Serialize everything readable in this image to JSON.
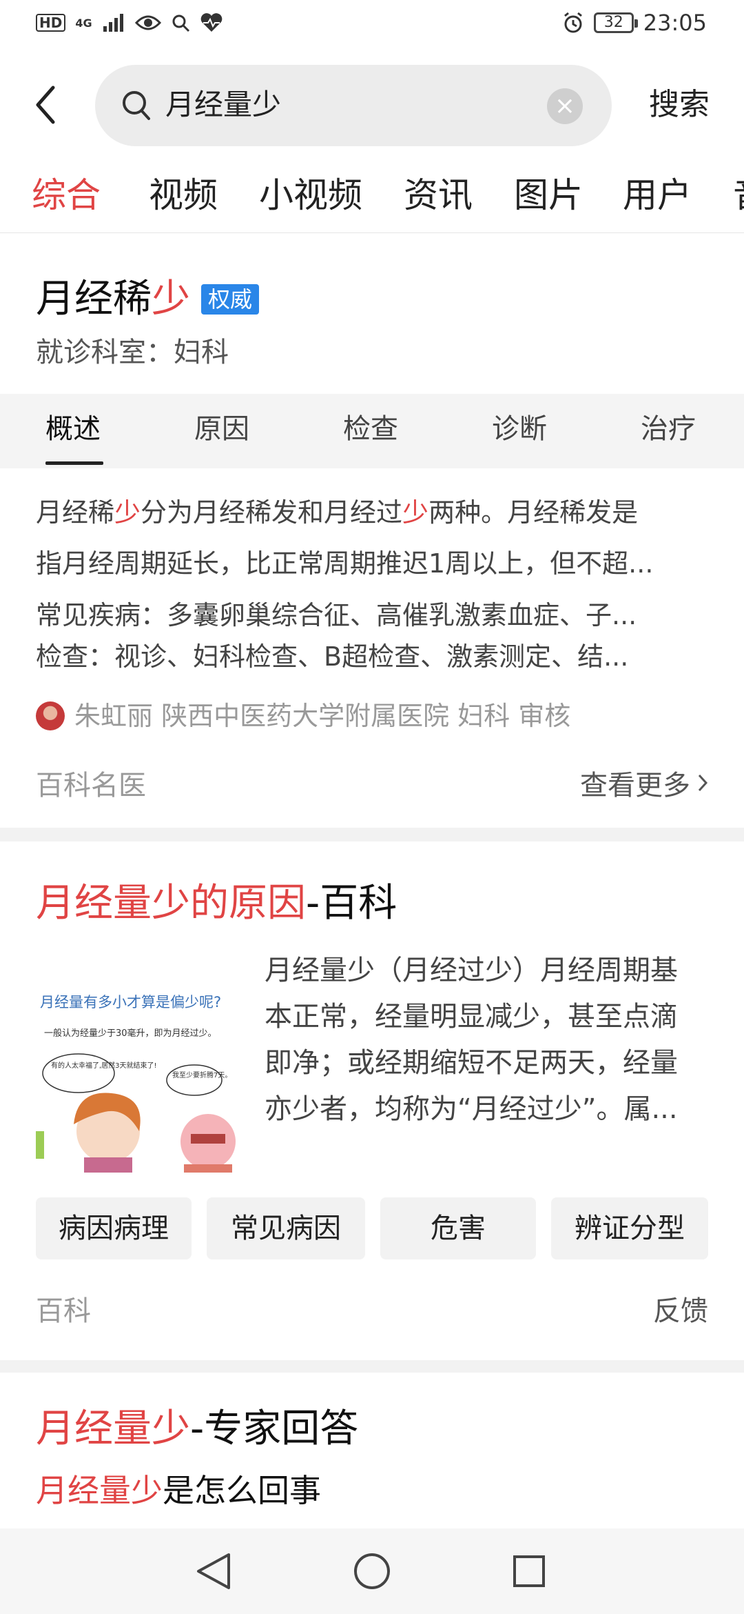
{
  "status_bar": {
    "hd": "HD",
    "network": "4G",
    "battery": "32",
    "time": "23:05"
  },
  "search": {
    "query": "月经量少",
    "submit_label": "搜索"
  },
  "category_tabs": [
    {
      "label": "综合",
      "active": true
    },
    {
      "label": "视频"
    },
    {
      "label": "小视频"
    },
    {
      "label": "资讯"
    },
    {
      "label": "图片"
    },
    {
      "label": "用户"
    },
    {
      "label": "音"
    }
  ],
  "card1": {
    "title_prefix": "月经稀",
    "title_highlight": "少",
    "badge": "权威",
    "department": "就诊科室：妇科",
    "tabs": [
      {
        "label": "概述",
        "active": true
      },
      {
        "label": "原因"
      },
      {
        "label": "检查"
      },
      {
        "label": "诊断"
      },
      {
        "label": "治疗"
      }
    ],
    "summary_line1": {
      "part1": "月经稀",
      "hl1": "少",
      "part2": "分为月经稀发和月经过",
      "hl2": "少",
      "part3": "两种。月经稀发是"
    },
    "summary_line2": "指月经周期延长，比正常周期推迟1周以上，但不超...",
    "diseases": "常见疾病：多囊卵巢综合征、高催乳激素血症、子...",
    "exams": "检查：视诊、妇科检查、B超检查、激素测定、结...",
    "reviewer": "朱虹丽 陕西中医药大学附属医院 妇科 审核",
    "source": "百科名医",
    "more_label": "查看更多"
  },
  "card2": {
    "title_highlight": "月经量少的原因",
    "title_suffix": "-百科",
    "text_lines": [
      "月经量少（月经过少）月经周期基",
      "本正常，经量明显减少，甚至点滴",
      "即净；或经期缩短不足两天，经量",
      "亦少者，均称为“月经过少”。属..."
    ],
    "thumbnail": {
      "heading": "月经量有多小才算是偏少呢?",
      "note": "一般认为经量少于30毫升，即为月经过少。",
      "bubble_left": "有的人太幸福了,居然3天就结束了!",
      "bubble_right": "我至少要折腾7天。"
    },
    "chips": [
      "病因病理",
      "常见病因",
      "危害",
      "辨证分型"
    ],
    "source": "百科",
    "feedback_label": "反馈"
  },
  "card3": {
    "title_highlight": "月经量少",
    "title_suffix": "-专家回答",
    "subtitle_highlight": "月经量少",
    "subtitle_suffix": "是怎么回事"
  },
  "colors": {
    "accent_red": "#e04444",
    "badge_blue": "#2a86e8"
  }
}
